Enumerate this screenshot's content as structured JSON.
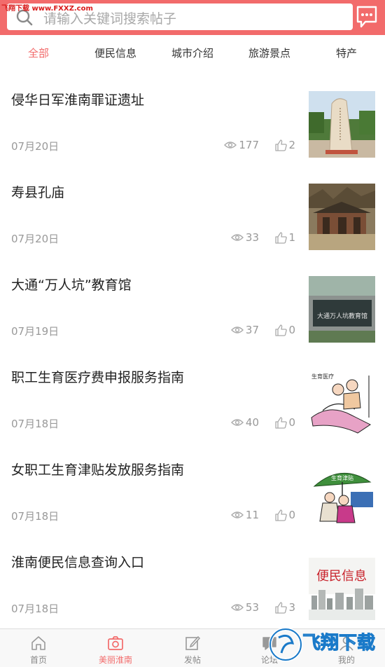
{
  "watermark": {
    "top_text": "飞翔下载 www.FXXZ.com",
    "logo_text": "飞翔下载"
  },
  "search": {
    "placeholder": "请输入关键词搜索帖子"
  },
  "tabs": [
    {
      "label": "全部",
      "active": true
    },
    {
      "label": "便民信息",
      "active": false
    },
    {
      "label": "城市介绍",
      "active": false
    },
    {
      "label": "旅游景点",
      "active": false
    },
    {
      "label": "特产",
      "active": false
    }
  ],
  "posts": [
    {
      "title": "侵华日军淮南罪证遗址",
      "date": "07月20日",
      "views": "177",
      "likes": "2",
      "thumb": "stone-monument"
    },
    {
      "title": "寿县孔庙",
      "date": "07月20日",
      "views": "33",
      "likes": "1",
      "thumb": "temple"
    },
    {
      "title": "大通“万人坑”教育馆",
      "date": "07月19日",
      "views": "37",
      "likes": "0",
      "thumb": "memorial-wall"
    },
    {
      "title": "职工生育医疗费申报服务指南",
      "date": "07月18日",
      "views": "40",
      "likes": "0",
      "thumb": "cartoon-hospital"
    },
    {
      "title": "女职工生育津贴发放服务指南",
      "date": "07月18日",
      "views": "11",
      "likes": "0",
      "thumb": "cartoon-umbrella"
    },
    {
      "title": "淮南便民信息查询入口",
      "date": "07月18日",
      "views": "53",
      "likes": "3",
      "thumb": "info-banner"
    }
  ],
  "thumb_texts": {
    "memorial": "大通万人坑教育馆",
    "hospital": "生育医疗",
    "umbrella": "生育津贴",
    "info": "便民信息"
  },
  "bottom_nav": [
    {
      "label": "首页",
      "icon": "home-icon",
      "active": false
    },
    {
      "label": "美丽淮南",
      "icon": "camera-icon",
      "active": true
    },
    {
      "label": "发帖",
      "icon": "edit-icon",
      "active": false
    },
    {
      "label": "论坛",
      "icon": "chat-icon",
      "active": false
    },
    {
      "label": "我的",
      "icon": "user-icon",
      "active": false
    }
  ],
  "colors": {
    "accent": "#f26b6b",
    "muted": "#999999"
  }
}
